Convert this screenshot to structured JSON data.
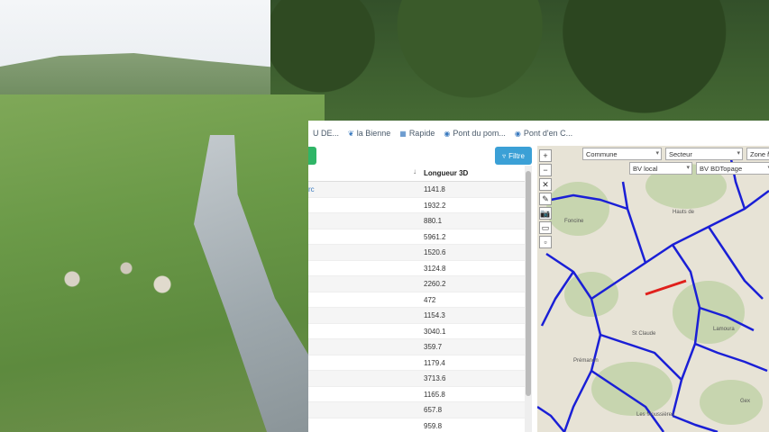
{
  "tabs": [
    {
      "icon": "",
      "label": "U DE..."
    },
    {
      "icon": "bird-icon",
      "glyph": "❦",
      "label": "la Bienne"
    },
    {
      "icon": "grid-icon",
      "glyph": "▦",
      "label": "Rapide"
    },
    {
      "icon": "map-pin-icon",
      "glyph": "◉",
      "label": "Pont du pom..."
    },
    {
      "icon": "map-pin-icon",
      "glyph": "◉",
      "label": "Pont d'en C..."
    }
  ],
  "toolbar": {
    "filter_label": "Filtre",
    "filter_glyph": "▿"
  },
  "table": {
    "sort_glyph": "↓",
    "column_header": "Longueur 3D",
    "first_row_link": "rc",
    "rows": [
      "1141.8",
      "1932.2",
      "880.1",
      "5961.2",
      "1520.6",
      "3124.8",
      "2260.2",
      "472",
      "1154.3",
      "3040.1",
      "359.7",
      "1179.4",
      "3713.6",
      "1165.8",
      "657.8",
      "959.8"
    ]
  },
  "map": {
    "controls": [
      "+",
      "−",
      "✕",
      "✎",
      "📷",
      "▭",
      "▫"
    ],
    "selects": {
      "commune": "Commune",
      "secteur": "Secteur",
      "zone": "Zone r",
      "bv_local": "BV local",
      "bv_bdtopage": "BV BDTopage"
    },
    "labels": [
      "Hauts de",
      "Foncine",
      "Lamoura",
      "Gex",
      "St Claude",
      "Les Moussières",
      "Prémanon"
    ],
    "colors": {
      "rivers": "#1a1fd6",
      "highlight": "#e0201c",
      "terrain": "#e7e3d6",
      "forest": "#b9cf9e"
    }
  }
}
